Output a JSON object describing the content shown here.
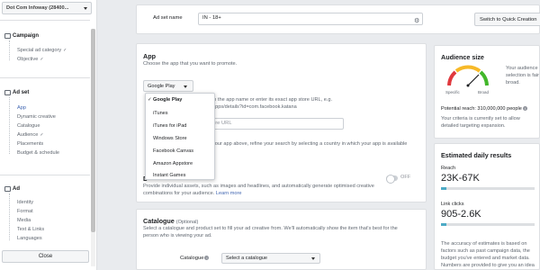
{
  "account": {
    "name": "Dot Com Infoway (28400..."
  },
  "nav": {
    "campaign": {
      "label": "Campaign",
      "items": [
        {
          "label": "Special ad category"
        },
        {
          "label": "Objective"
        }
      ]
    },
    "adset": {
      "label": "Ad set",
      "items": [
        {
          "label": "App"
        },
        {
          "label": "Dynamic creative"
        },
        {
          "label": "Catalogue"
        },
        {
          "label": "Audience"
        },
        {
          "label": "Placements"
        },
        {
          "label": "Budget & schedule"
        }
      ]
    },
    "ad": {
      "label": "Ad",
      "items": [
        {
          "label": "Identity"
        },
        {
          "label": "Format"
        },
        {
          "label": "Media"
        },
        {
          "label": "Text & Links"
        },
        {
          "label": "Languages"
        }
      ]
    },
    "close_label": "Close"
  },
  "topbar": {
    "adset_name_label": "Ad set name",
    "adset_name_value": "IN - 18+",
    "quick_creation_label": "Switch to Quick Creation"
  },
  "app": {
    "title": "App",
    "subtitle": "Choose the app that you want to promote.",
    "store_value": "Google Play",
    "menu": [
      "Google Play",
      "iTunes",
      "iTunes for iPad",
      "Windows Store",
      "Facebook Canvas",
      "Amazon Appstore",
      "Instant Games"
    ],
    "hint_line1": "in the app name or enter its exact app store URL, e.g.",
    "hint_line2": "apps/details?id=com.facebook.katana",
    "store_url_placeholder": "ore URL",
    "refine_text": "your app above, refine your search by selecting a country in which your app is available",
    "dynamic_title": "D",
    "dynamic_text1": "Provide individual assets, such as images and headlines, and automatically generate optimised creative",
    "dynamic_text2": "combinations for your audience.",
    "learn_more": "Learn more",
    "toggle_label": "OFF"
  },
  "catalogue": {
    "title": "Catalogue",
    "optional": "(Optional)",
    "desc1": "Select a catalogue and product set to fill your ad creative from. We'll automatically show the item that's best for the",
    "desc2": "person who is viewing your ad.",
    "field_label": "Catalogue",
    "select_value": "Select a catalogue"
  },
  "audience_size": {
    "title": "Audience size",
    "specific": "Specific",
    "broad": "Broad",
    "side1": "Your audience",
    "side2": "selection is fair",
    "side3": "broad.",
    "reach_text": "Potential reach: 310,000,000 people",
    "criteria1": "Your criteria is currently set to allow",
    "criteria2": "detailed targeting expansion."
  },
  "estimates": {
    "title": "Estimated daily results",
    "reach_label": "Reach",
    "reach_value": "23K-67K",
    "reach_fill": 0.06,
    "clicks_label": "Link clicks",
    "clicks_value": "905-2.6K",
    "clicks_fill": 0.06,
    "note1": "The accuracy of estimates is based on",
    "note2": "factors such as past campaign data, the",
    "note3": "budget you've entered and market data.",
    "note4": "Numbers are provided to give you an idea"
  },
  "colors": {
    "accent": "#4267b2",
    "gauge_red": "#e0393e",
    "gauge_yellow": "#f7b928",
    "gauge_green": "#42b72a",
    "bar": "#4daac5"
  }
}
